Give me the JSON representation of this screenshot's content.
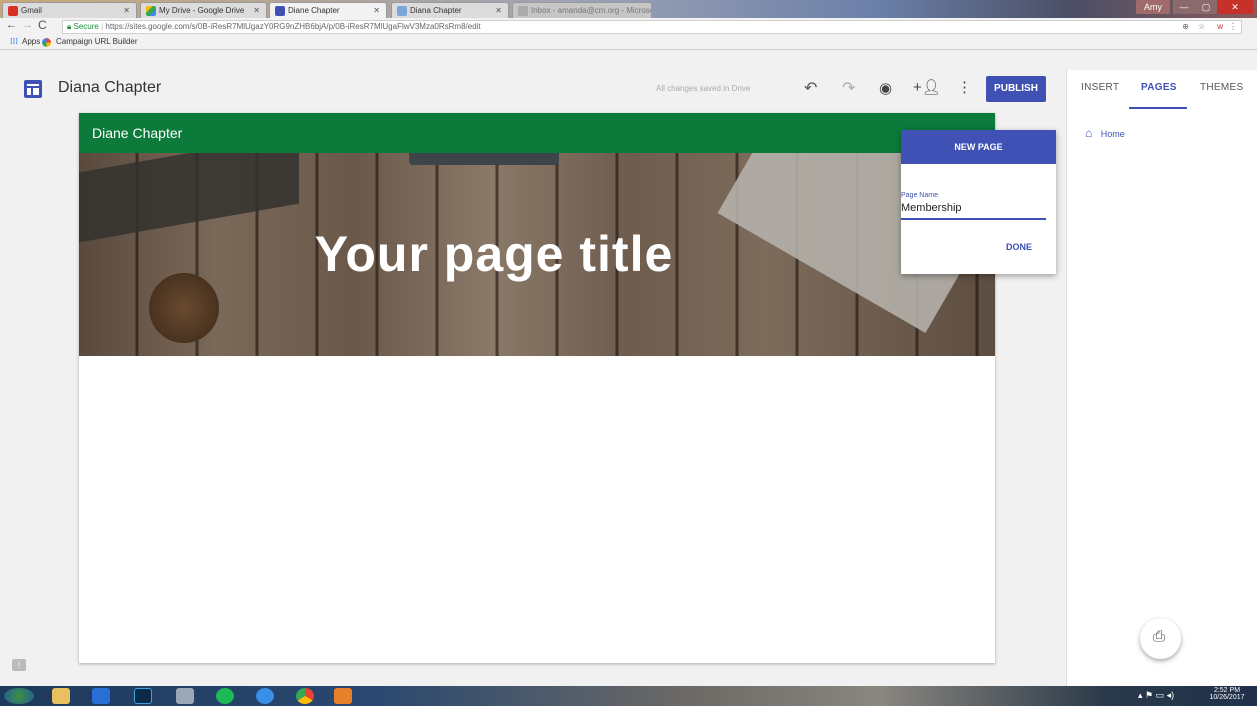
{
  "browser": {
    "tabs": [
      {
        "title": "Gmail"
      },
      {
        "title": "My Drive - Google Drive"
      },
      {
        "title": "Diane Chapter"
      },
      {
        "title": "Diana Chapter"
      },
      {
        "title": "Inbox - amanda@cm.org - Microsoft Outlook"
      }
    ],
    "user_chip": "Amy",
    "url_secure": "Secure",
    "url": "https://sites.google.com/s/0B-iResR7MlUgazY0RG9nZHB6bjA/p/0B-iResR7MlUgaFlwV3Mza0RsRm8/edit",
    "bookmarks": [
      {
        "label": "Apps"
      },
      {
        "label": "Campaign URL Builder"
      }
    ]
  },
  "app": {
    "site_name": "Diana Chapter",
    "save_status": "All changes saved in Drive",
    "publish_label": "PUBLISH"
  },
  "panel": {
    "tabs": [
      {
        "label": "INSERT"
      },
      {
        "label": "PAGES"
      },
      {
        "label": "THEMES"
      }
    ],
    "pages": [
      {
        "label": "Home"
      }
    ]
  },
  "canvas": {
    "site_title": "Diane Chapter",
    "page_title": "Your page title"
  },
  "new_page_dialog": {
    "title": "NEW PAGE",
    "field_label": "Page Name",
    "field_value": "Membership",
    "done_label": "DONE"
  },
  "taskbar": {
    "time": "2:52 PM",
    "date": "10/26/2017"
  },
  "colors": {
    "accent": "#3f51b5",
    "site_header": "#0b7a3b"
  }
}
